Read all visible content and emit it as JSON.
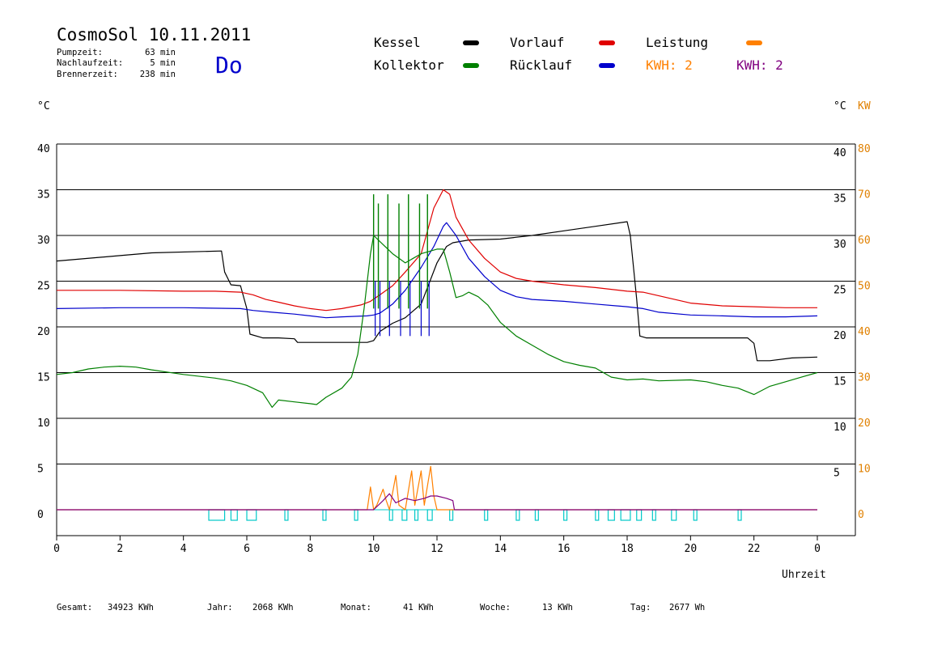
{
  "header": {
    "title": "CosmoSol 10.11.2011",
    "day": "Do",
    "stats": [
      {
        "label": "Pumpzeit:",
        "value": "63 min"
      },
      {
        "label": "Nachlaufzeit:",
        "value": "5 min"
      },
      {
        "label": "Brennerzeit:",
        "value": "238 min"
      }
    ]
  },
  "legend": {
    "kessel": "Kessel",
    "kollektor": "Kollektor",
    "vorlauf": "Vorlauf",
    "ruecklauf": "Rücklauf",
    "leistung": "Leistung",
    "kwh_orange": "KWH: 2",
    "kwh_purple": "KWH: 2"
  },
  "axes": {
    "left_unit": "°C",
    "right_unit": "°C",
    "right_unit2": "KW",
    "x_label": "Uhrzeit"
  },
  "footer": {
    "gesamt": {
      "label": "Gesamt:",
      "value": "34923 KWh"
    },
    "jahr": {
      "label": "Jahr:",
      "value": "2068 KWh"
    },
    "monat": {
      "label": "Monat:",
      "value": "41 KWh"
    },
    "woche": {
      "label": "Woche:",
      "value": "13 KWh"
    },
    "tag": {
      "label": "Tag:",
      "value": "2677 Wh"
    }
  },
  "colors": {
    "kessel": "#000000",
    "kollektor": "#008000",
    "vorlauf": "#e00000",
    "ruecklauf": "#0000cc",
    "leistung": "#ff8000",
    "kwh_purple": "#800080",
    "pump": "#00c8c8",
    "day": "#0000cc"
  },
  "chart_data": {
    "type": "line",
    "x_unit": "hour",
    "xlim": [
      0,
      24
    ],
    "ylim": [
      0,
      40
    ],
    "ylim_right_kw": [
      0,
      80
    ],
    "x_ticks": [
      "0",
      "2",
      "4",
      "6",
      "8",
      "10",
      "12",
      "14",
      "16",
      "18",
      "20",
      "22",
      "0"
    ],
    "y_ticks_left": [
      "0",
      "5",
      "10",
      "15",
      "20",
      "25",
      "30",
      "35",
      "40"
    ],
    "y_ticks_right": [
      "5",
      "10",
      "15",
      "20",
      "25",
      "30",
      "35",
      "40"
    ],
    "y_ticks_kw": [
      "0",
      "10",
      "20",
      "30",
      "40",
      "50",
      "60",
      "70",
      "80"
    ],
    "grid": true,
    "series": [
      {
        "key": "kessel",
        "name": "Kessel",
        "color": "#000000",
        "points": [
          [
            0,
            27.2
          ],
          [
            2,
            27.8
          ],
          [
            3,
            28.1
          ],
          [
            5.2,
            28.3
          ],
          [
            5.3,
            26
          ],
          [
            5.5,
            24.6
          ],
          [
            5.8,
            24.5
          ],
          [
            6,
            22
          ],
          [
            6.1,
            19.2
          ],
          [
            6.5,
            18.8
          ],
          [
            7,
            18.8
          ],
          [
            7.5,
            18.7
          ],
          [
            7.6,
            18.3
          ],
          [
            9,
            18.3
          ],
          [
            9.8,
            18.3
          ],
          [
            10,
            18.5
          ],
          [
            10.2,
            19.5
          ],
          [
            10.6,
            20.4
          ],
          [
            11,
            21
          ],
          [
            11.5,
            22.5
          ],
          [
            12,
            27
          ],
          [
            12.3,
            28.8
          ],
          [
            12.5,
            29.2
          ],
          [
            13,
            29.5
          ],
          [
            14,
            29.6
          ],
          [
            15,
            30
          ],
          [
            16,
            30.5
          ],
          [
            17,
            31
          ],
          [
            18,
            31.5
          ],
          [
            18.1,
            30
          ],
          [
            18.3,
            23
          ],
          [
            18.4,
            19
          ],
          [
            18.6,
            18.8
          ],
          [
            19,
            18.8
          ],
          [
            20,
            18.8
          ],
          [
            21,
            18.8
          ],
          [
            21.8,
            18.8
          ],
          [
            22,
            18.2
          ],
          [
            22.1,
            16.3
          ],
          [
            22.5,
            16.3
          ],
          [
            23.2,
            16.6
          ],
          [
            24,
            16.7
          ]
        ]
      },
      {
        "key": "vorlauf",
        "name": "Vorlauf",
        "color": "#e00000",
        "points": [
          [
            0,
            24
          ],
          [
            2,
            24
          ],
          [
            4,
            23.9
          ],
          [
            5,
            23.9
          ],
          [
            5.8,
            23.8
          ],
          [
            6.2,
            23.5
          ],
          [
            6.6,
            23
          ],
          [
            7,
            22.7
          ],
          [
            7.5,
            22.3
          ],
          [
            8,
            22
          ],
          [
            8.5,
            21.8
          ],
          [
            9,
            22
          ],
          [
            9.6,
            22.4
          ],
          [
            9.9,
            22.8
          ],
          [
            10.2,
            23.5
          ],
          [
            10.6,
            24.5
          ],
          [
            11,
            26
          ],
          [
            11.5,
            28
          ],
          [
            11.9,
            33
          ],
          [
            12.2,
            35
          ],
          [
            12.4,
            34.5
          ],
          [
            12.6,
            32
          ],
          [
            13,
            29.5
          ],
          [
            13.5,
            27.5
          ],
          [
            14,
            26
          ],
          [
            14.5,
            25.3
          ],
          [
            15,
            25
          ],
          [
            16,
            24.6
          ],
          [
            17,
            24.3
          ],
          [
            18,
            23.9
          ],
          [
            18.5,
            23.8
          ],
          [
            19,
            23.4
          ],
          [
            20,
            22.6
          ],
          [
            21,
            22.3
          ],
          [
            22,
            22.2
          ],
          [
            23,
            22.1
          ],
          [
            24,
            22.1
          ]
        ]
      },
      {
        "key": "ruecklauf",
        "name": "Rücklauf",
        "color": "#0000cc",
        "points": [
          [
            0,
            22
          ],
          [
            2,
            22.1
          ],
          [
            4,
            22.1
          ],
          [
            5.8,
            22
          ],
          [
            6.2,
            21.8
          ],
          [
            6.8,
            21.6
          ],
          [
            7.5,
            21.4
          ],
          [
            8,
            21.2
          ],
          [
            8.5,
            21
          ],
          [
            9,
            21.1
          ],
          [
            9.8,
            21.2
          ],
          [
            10,
            21.3
          ],
          [
            10.2,
            21.5
          ],
          [
            10.6,
            22.5
          ],
          [
            11,
            24
          ],
          [
            11.5,
            26.5
          ],
          [
            11.9,
            28.8
          ],
          [
            12.2,
            31
          ],
          [
            12.3,
            31.4
          ],
          [
            12.6,
            30
          ],
          [
            13,
            27.5
          ],
          [
            13.5,
            25.5
          ],
          [
            14,
            24
          ],
          [
            14.5,
            23.3
          ],
          [
            15,
            23
          ],
          [
            16,
            22.8
          ],
          [
            17,
            22.5
          ],
          [
            18,
            22.2
          ],
          [
            18.5,
            22
          ],
          [
            19,
            21.6
          ],
          [
            20,
            21.3
          ],
          [
            21,
            21.2
          ],
          [
            22,
            21.1
          ],
          [
            23,
            21.1
          ],
          [
            24,
            21.2
          ]
        ]
      },
      {
        "key": "kollektor",
        "name": "Kollektor",
        "color": "#008000",
        "points": [
          [
            0,
            14.8
          ],
          [
            0.5,
            15
          ],
          [
            1,
            15.4
          ],
          [
            1.5,
            15.6
          ],
          [
            2,
            15.7
          ],
          [
            2.5,
            15.6
          ],
          [
            3,
            15.3
          ],
          [
            4,
            14.8
          ],
          [
            5,
            14.4
          ],
          [
            5.5,
            14.1
          ],
          [
            6,
            13.6
          ],
          [
            6.5,
            12.8
          ],
          [
            6.8,
            11.2
          ],
          [
            7,
            12
          ],
          [
            7.5,
            11.8
          ],
          [
            8,
            11.6
          ],
          [
            8.2,
            11.5
          ],
          [
            8.5,
            12.3
          ],
          [
            9,
            13.3
          ],
          [
            9.3,
            14.5
          ],
          [
            9.5,
            17
          ],
          [
            9.7,
            22
          ],
          [
            9.9,
            28
          ],
          [
            10,
            30
          ],
          [
            10.3,
            29
          ],
          [
            10.6,
            28
          ],
          [
            11,
            27
          ],
          [
            11.5,
            28
          ],
          [
            12,
            28.5
          ],
          [
            12.2,
            28.5
          ],
          [
            12.4,
            26
          ],
          [
            12.6,
            23.2
          ],
          [
            12.8,
            23.4
          ],
          [
            13,
            23.8
          ],
          [
            13.3,
            23.3
          ],
          [
            13.6,
            22.4
          ],
          [
            14,
            20.5
          ],
          [
            14.5,
            19
          ],
          [
            15,
            18
          ],
          [
            15.5,
            17
          ],
          [
            16,
            16.2
          ],
          [
            16.5,
            15.8
          ],
          [
            17,
            15.5
          ],
          [
            17.5,
            14.5
          ],
          [
            18,
            14.2
          ],
          [
            18.5,
            14.3
          ],
          [
            19,
            14.1
          ],
          [
            20,
            14.2
          ],
          [
            20.5,
            14
          ],
          [
            21,
            13.6
          ],
          [
            21.5,
            13.3
          ],
          [
            22,
            12.6
          ],
          [
            22.5,
            13.5
          ],
          [
            23,
            14
          ],
          [
            23.5,
            14.5
          ],
          [
            24,
            15
          ]
        ]
      },
      {
        "key": "leistung",
        "name": "Leistung",
        "color": "#ff8000",
        "unit": "KW",
        "points": [
          [
            0,
            0
          ],
          [
            9.8,
            0
          ],
          [
            9.9,
            5
          ],
          [
            10,
            0
          ],
          [
            10.1,
            1
          ],
          [
            10.3,
            4.5
          ],
          [
            10.4,
            2
          ],
          [
            10.5,
            0
          ],
          [
            10.7,
            7.5
          ],
          [
            10.8,
            1
          ],
          [
            11,
            0
          ],
          [
            11.2,
            8.5
          ],
          [
            11.3,
            1
          ],
          [
            11.5,
            8.5
          ],
          [
            11.6,
            1
          ],
          [
            11.8,
            9.5
          ],
          [
            11.9,
            3
          ],
          [
            12,
            0
          ],
          [
            24,
            0
          ]
        ]
      },
      {
        "key": "kwh_purple",
        "name": "KWH",
        "color": "#800080",
        "unit": "KW",
        "points": [
          [
            0,
            0
          ],
          [
            10,
            0
          ],
          [
            10.3,
            2
          ],
          [
            10.5,
            3.5
          ],
          [
            10.7,
            1.5
          ],
          [
            11,
            2.5
          ],
          [
            11.3,
            2
          ],
          [
            11.6,
            2.5
          ],
          [
            11.8,
            3
          ],
          [
            12,
            3
          ],
          [
            12.3,
            2.5
          ],
          [
            12.5,
            2
          ],
          [
            12.55,
            0
          ],
          [
            24,
            0
          ]
        ]
      }
    ]
  }
}
